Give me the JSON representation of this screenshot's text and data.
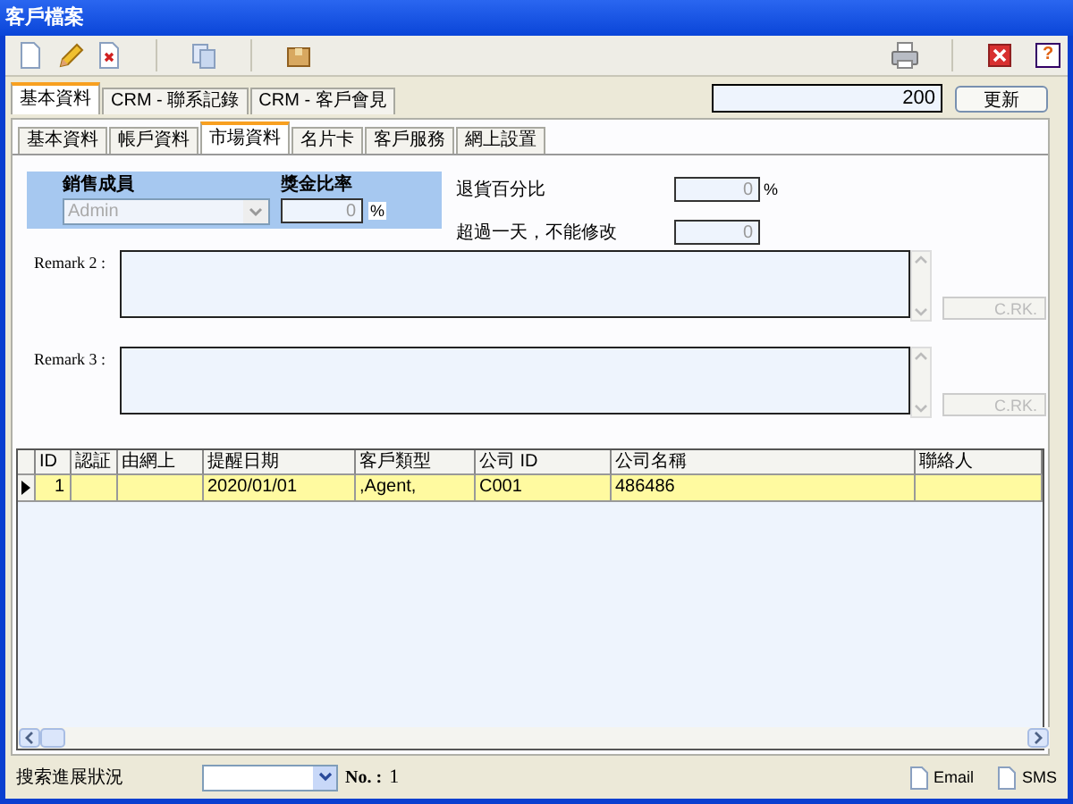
{
  "window": {
    "title": "客戶檔案"
  },
  "toolbar": {
    "help_label": "?"
  },
  "refresh": {
    "value": "200",
    "button": "更新"
  },
  "main_tabs": [
    {
      "label": "基本資料",
      "selected": true
    },
    {
      "label": "CRM - 聯系記錄",
      "selected": false
    },
    {
      "label": "CRM - 客戶會見",
      "selected": false
    }
  ],
  "sub_tabs": [
    {
      "label": "基本資料",
      "selected": false
    },
    {
      "label": "帳戶資料",
      "selected": false
    },
    {
      "label": "市場資料",
      "selected": true
    },
    {
      "label": "名片卡",
      "selected": false
    },
    {
      "label": "客戶服務",
      "selected": false
    },
    {
      "label": "網上設置",
      "selected": false
    }
  ],
  "form": {
    "sales_member": {
      "label": "銷售成員",
      "value": "Admin",
      "disabled": true
    },
    "commission": {
      "label": "獎金比率",
      "value": "0",
      "unit": "%",
      "disabled": true
    },
    "return_pct": {
      "label": "退貨百分比",
      "value": "0",
      "unit": "%",
      "disabled": true
    },
    "over_day": {
      "label": "超過一天，不能修改",
      "value": "0",
      "disabled": true
    }
  },
  "remarks": [
    {
      "label": "Remark 2 :",
      "button": "C.RK.",
      "disabled": true
    },
    {
      "label": "Remark 3 :",
      "button": "C.RK.",
      "disabled": true
    }
  ],
  "table": {
    "columns": [
      "ID",
      "認証",
      "由網上",
      "提醒日期",
      "客戶類型",
      "公司 ID",
      "公司名稱",
      "聯絡人"
    ],
    "rows": [
      {
        "cells": [
          "1",
          "",
          "",
          "2020/01/01",
          ",Agent,",
          "C001",
          "486486",
          ""
        ],
        "selected": true
      }
    ]
  },
  "bottom": {
    "search_label": "搜索進展狀況",
    "no_label": "No. :",
    "no_value": "1",
    "links": [
      "Email",
      "SMS"
    ]
  }
}
